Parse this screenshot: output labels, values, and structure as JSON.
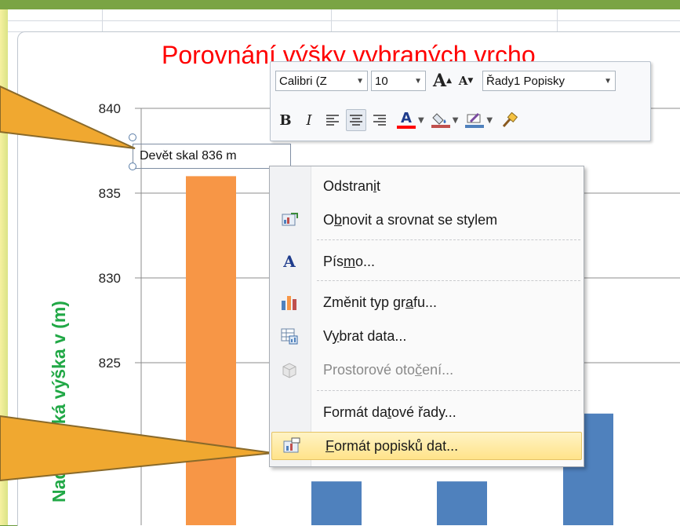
{
  "chart": {
    "title": "Porovnání výšky vybraných vrcho",
    "y_axis_label": "Nadmořská výška v (m)",
    "selected_data_label": "Devět skal 836 m"
  },
  "chart_data": {
    "type": "bar",
    "title": "Porovnání výšky vybraných vrcho",
    "ylabel": "Nadmořská výška v (m)",
    "ylim": [
      820,
      840
    ],
    "y_ticks": [
      840,
      835,
      830,
      825
    ],
    "grid": true,
    "series": [
      {
        "values": [
          836,
          818,
          818,
          822
        ]
      }
    ],
    "bar_colors": [
      "#f79646",
      "#4f81bd",
      "#4f81bd",
      "#4f81bd"
    ],
    "data_labels": [
      "Devět skal 836 m"
    ]
  },
  "mini_toolbar": {
    "font_name": "Calibri (Z",
    "font_size": "10",
    "grow_font": "A",
    "shrink_font": "A",
    "element_selector": "Řady1 Popisky",
    "bold": "B",
    "italic": "I",
    "font_color": "A"
  },
  "context_menu": {
    "items": [
      {
        "pre": "Odstran",
        "ul": "i",
        "post": "t",
        "icon": ""
      },
      {
        "pre": "O",
        "ul": "b",
        "post": "novit a srovnat se stylem",
        "icon": "reset-style-icon"
      },
      {
        "pre": "Pís",
        "ul": "m",
        "post": "o...",
        "icon": "font-icon"
      },
      {
        "pre": "Změnit typ gr",
        "ul": "a",
        "post": "fu...",
        "icon": "chart-type-icon"
      },
      {
        "pre": "V",
        "ul": "y",
        "post": "brat data...",
        "icon": "select-data-icon"
      },
      {
        "pre": "Prostorové oto",
        "ul": "č",
        "post": "ení...",
        "icon": "3d-rotation-icon"
      },
      {
        "pre": "Formát da",
        "ul": "t",
        "post": "ové řady...",
        "icon": ""
      },
      {
        "pre": "",
        "ul": "F",
        "post": "ormát popisků dat...",
        "icon": "format-data-labels-icon"
      }
    ]
  },
  "colors": {
    "title": "#ff0000",
    "axis_label": "#21a846",
    "highlight_bar": "#f79646",
    "bar": "#4f81bd",
    "callout": "#f0a830"
  }
}
